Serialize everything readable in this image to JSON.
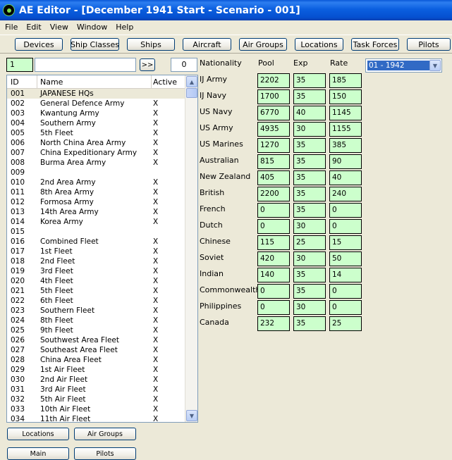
{
  "window": {
    "title": "AE Editor - [December 1941 Start - Scenario - 001]"
  },
  "menu": [
    "File",
    "Edit",
    "View",
    "Window",
    "Help"
  ],
  "toolbar": [
    "Devices",
    "Ship Classes",
    "Ships",
    "Aircraft",
    "Air Groups",
    "Locations",
    "Task Forces",
    "Pilots"
  ],
  "search": {
    "id_value": "1",
    "name_value": "",
    "go_label": ">>",
    "count": "0"
  },
  "list": {
    "headers": {
      "id": "ID",
      "name": "Name",
      "active": "Active"
    },
    "rows": [
      {
        "id": "001",
        "name": "JAPANESE HQs",
        "active": ""
      },
      {
        "id": "002",
        "name": "General Defence Army",
        "active": "X"
      },
      {
        "id": "003",
        "name": "Kwantung Army",
        "active": "X"
      },
      {
        "id": "004",
        "name": "Southern Army",
        "active": "X"
      },
      {
        "id": "005",
        "name": "5th Fleet",
        "active": "X"
      },
      {
        "id": "006",
        "name": "North China Area Army",
        "active": "X"
      },
      {
        "id": "007",
        "name": "China Expeditionary Army",
        "active": "X"
      },
      {
        "id": "008",
        "name": "Burma Area Army",
        "active": "X"
      },
      {
        "id": "009",
        "name": "",
        "active": ""
      },
      {
        "id": "010",
        "name": "2nd Area Army",
        "active": "X"
      },
      {
        "id": "011",
        "name": "8th Area Army",
        "active": "X"
      },
      {
        "id": "012",
        "name": "Formosa Army",
        "active": "X"
      },
      {
        "id": "013",
        "name": "14th Area Army",
        "active": "X"
      },
      {
        "id": "014",
        "name": "Korea Army",
        "active": "X"
      },
      {
        "id": "015",
        "name": "",
        "active": ""
      },
      {
        "id": "016",
        "name": "Combined Fleet",
        "active": "X"
      },
      {
        "id": "017",
        "name": "1st Fleet",
        "active": "X"
      },
      {
        "id": "018",
        "name": "2nd Fleet",
        "active": "X"
      },
      {
        "id": "019",
        "name": "3rd Fleet",
        "active": "X"
      },
      {
        "id": "020",
        "name": "4th Fleet",
        "active": "X"
      },
      {
        "id": "021",
        "name": "5th Fleet",
        "active": "X"
      },
      {
        "id": "022",
        "name": "6th Fleet",
        "active": "X"
      },
      {
        "id": "023",
        "name": "Southern Fleet",
        "active": "X"
      },
      {
        "id": "024",
        "name": "8th Fleet",
        "active": "X"
      },
      {
        "id": "025",
        "name": "9th Fleet",
        "active": "X"
      },
      {
        "id": "026",
        "name": "Southwest Area Fleet",
        "active": "X"
      },
      {
        "id": "027",
        "name": "Southeast Area Fleet",
        "active": "X"
      },
      {
        "id": "028",
        "name": "China Area Fleet",
        "active": "X"
      },
      {
        "id": "029",
        "name": "1st Air Fleet",
        "active": "X"
      },
      {
        "id": "030",
        "name": "2nd Air Fleet",
        "active": "X"
      },
      {
        "id": "031",
        "name": "3rd Air Fleet",
        "active": "X"
      },
      {
        "id": "032",
        "name": "5th Air Fleet",
        "active": "X"
      },
      {
        "id": "033",
        "name": "10th Air Fleet",
        "active": "X"
      },
      {
        "id": "034",
        "name": "11th Air Fleet",
        "active": "X"
      }
    ]
  },
  "bottom_buttons": [
    "Locations",
    "Air Groups",
    "Main",
    "Pilots"
  ],
  "nationality": {
    "headers": {
      "nationality": "Nationality",
      "pool": "Pool",
      "exp": "Exp",
      "rate": "Rate"
    },
    "rows": [
      {
        "name": "IJ Army",
        "pool": "2202",
        "exp": "35",
        "rate": "185"
      },
      {
        "name": "IJ Navy",
        "pool": "1700",
        "exp": "35",
        "rate": "150"
      },
      {
        "name": "US Navy",
        "pool": "6770",
        "exp": "40",
        "rate": "1145"
      },
      {
        "name": "US Army",
        "pool": "4935",
        "exp": "30",
        "rate": "1155"
      },
      {
        "name": "US Marines",
        "pool": "1270",
        "exp": "35",
        "rate": "385"
      },
      {
        "name": "Australian",
        "pool": "815",
        "exp": "35",
        "rate": "90"
      },
      {
        "name": "New Zealand",
        "pool": "405",
        "exp": "35",
        "rate": "40"
      },
      {
        "name": "British",
        "pool": "2200",
        "exp": "35",
        "rate": "240"
      },
      {
        "name": "French",
        "pool": "0",
        "exp": "35",
        "rate": "0"
      },
      {
        "name": "Dutch",
        "pool": "0",
        "exp": "30",
        "rate": "0"
      },
      {
        "name": "Chinese",
        "pool": "115",
        "exp": "25",
        "rate": "15"
      },
      {
        "name": "Soviet",
        "pool": "420",
        "exp": "30",
        "rate": "50"
      },
      {
        "name": "Indian",
        "pool": "140",
        "exp": "35",
        "rate": "14"
      },
      {
        "name": "Commonwealth",
        "pool": "0",
        "exp": "35",
        "rate": "0"
      },
      {
        "name": "Philippines",
        "pool": "0",
        "exp": "30",
        "rate": "0"
      },
      {
        "name": "Canada",
        "pool": "232",
        "exp": "35",
        "rate": "25"
      }
    ]
  },
  "date_select": {
    "value": "01 - 1942"
  },
  "icons": {
    "app": "app-icon",
    "scroll_up": "scroll-up-icon",
    "scroll_down": "scroll-down-icon",
    "dropdown": "chevron-down-icon"
  }
}
